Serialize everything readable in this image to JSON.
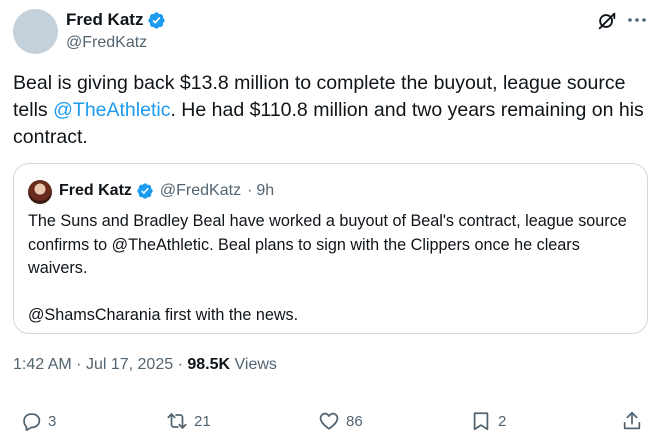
{
  "author": {
    "display_name": "Fred Katz",
    "handle": "@FredKatz"
  },
  "tweet": {
    "text_before": "Beal is giving back $13.8 million to complete the buyout, league source tells ",
    "mention": "@TheAthletic",
    "text_after": ". He had $110.8 million and two years remaining on his contract."
  },
  "quote": {
    "display_name": "Fred Katz",
    "handle": "@FredKatz",
    "separator": "·",
    "age": "9h",
    "paragraph1": "The Suns and Bradley Beal have worked a buyout of Beal's contract, league source confirms to @TheAthletic. Beal plans to sign with the Clippers once he clears waivers.",
    "paragraph2": "@ShamsCharania first with the news."
  },
  "meta": {
    "time": "1:42 AM",
    "separator": "·",
    "date": "Jul 17, 2025",
    "views_count": "98.5K",
    "views_label": "Views"
  },
  "actions": {
    "replies": "3",
    "reposts": "21",
    "likes": "86",
    "bookmarks": "2"
  },
  "icons": {
    "verified": "verified-badge-icon",
    "grok": "grok-icon",
    "more": "more-icon",
    "reply": "reply-icon",
    "repost": "repost-icon",
    "like": "heart-icon",
    "bookmark": "bookmark-icon",
    "share": "share-icon"
  },
  "colors": {
    "accent": "#1d9bf0",
    "text": "#0f1419",
    "muted": "#536471",
    "border": "#cfd9de"
  }
}
